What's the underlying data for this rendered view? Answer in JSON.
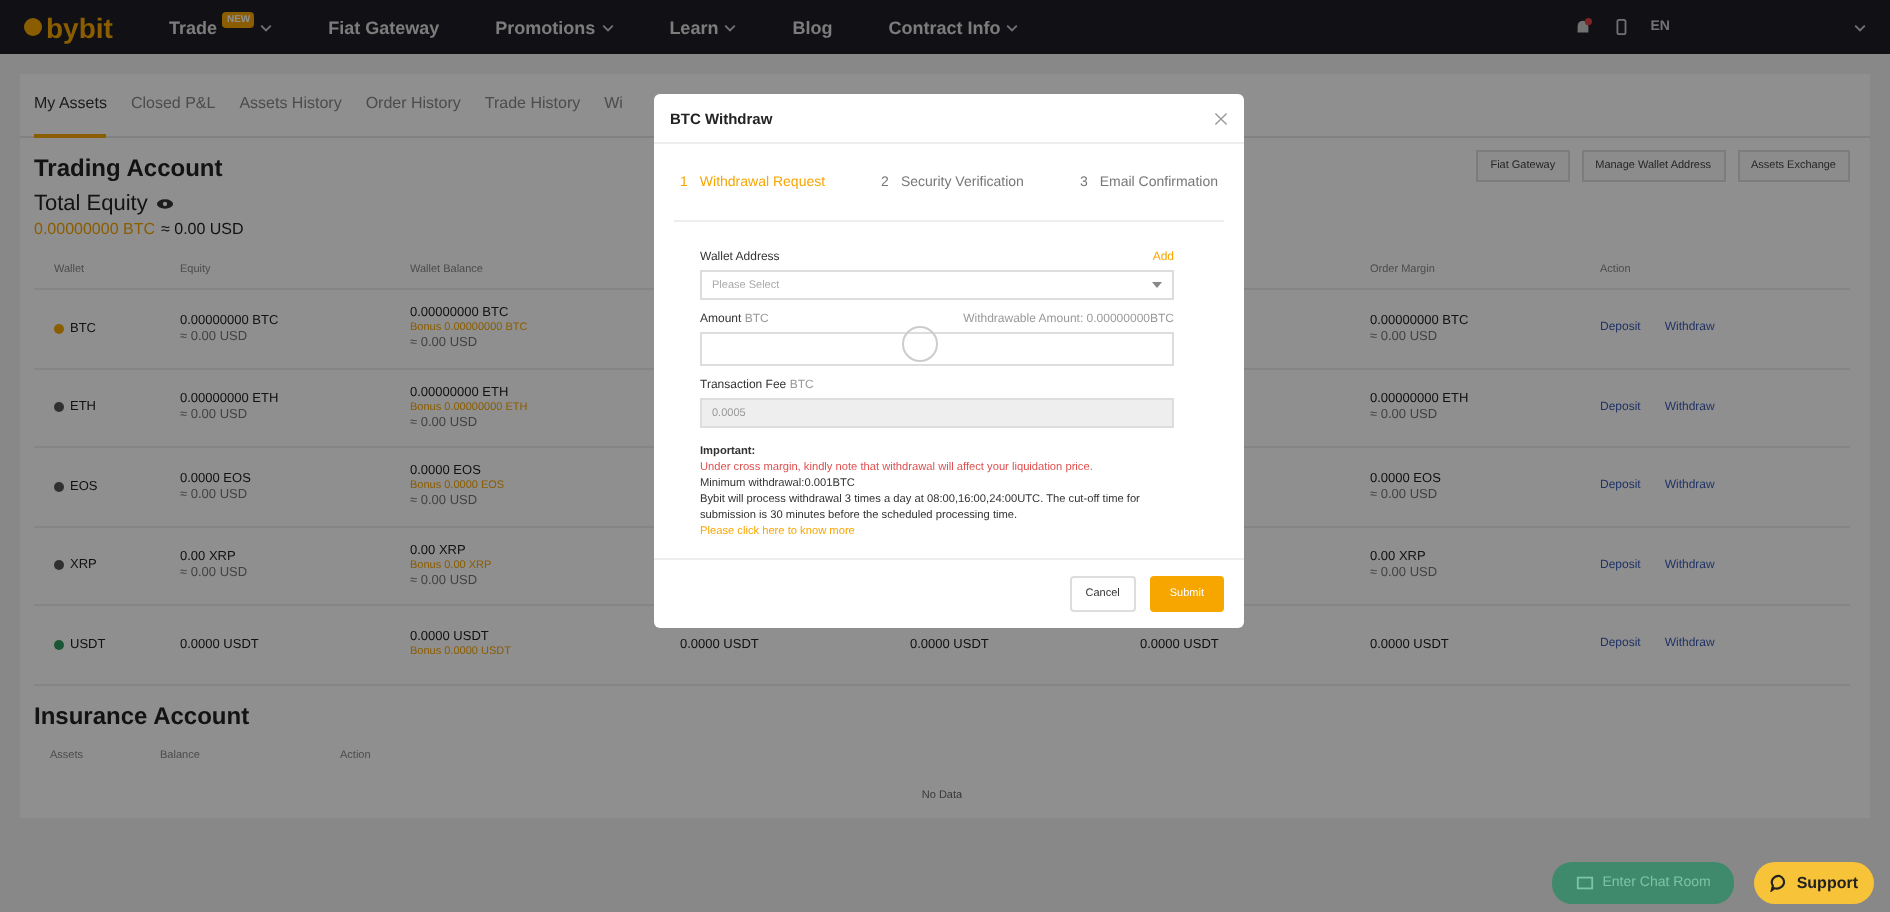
{
  "nav": {
    "logo": "bybit",
    "items": [
      {
        "label": "Trade",
        "badge": "NEW",
        "caret": true
      },
      {
        "label": "Fiat Gateway",
        "caret": false
      },
      {
        "label": "Promotions",
        "caret": true
      },
      {
        "label": "Learn",
        "caret": true
      },
      {
        "label": "Blog",
        "caret": false
      },
      {
        "label": "Contract Info",
        "caret": true
      }
    ],
    "language": "EN"
  },
  "tabs": [
    {
      "label": "My Assets",
      "selected": true
    },
    {
      "label": "Closed P&L",
      "selected": false
    },
    {
      "label": "Assets History",
      "selected": false
    },
    {
      "label": "Order History",
      "selected": false
    },
    {
      "label": "Trade History",
      "selected": false
    },
    {
      "label": "Wi",
      "selected": false
    }
  ],
  "trading_account": {
    "title": "Trading Account",
    "buttons": [
      "Fiat Gateway",
      "Manage Wallet Address",
      "Assets Exchange"
    ],
    "total_equity": {
      "label": "Total Equity",
      "btc": "0.00000000 BTC",
      "usd": "≈ 0.00 USD"
    },
    "columns": {
      "wallet": "Wallet",
      "equity": "Equity",
      "wallet_balance": "Wallet Balance",
      "order_margin": "Order Margin",
      "action": "Action"
    },
    "rows": [
      {
        "wallet": "BTC",
        "color": "#8a5d00",
        "equity": [
          {
            "kind": "main",
            "text": "0.00000000 BTC"
          },
          {
            "kind": "usd",
            "text": "≈ 0.00 USD"
          }
        ],
        "wallet_balance": [
          {
            "kind": "main",
            "text": "0.00000000 BTC"
          },
          {
            "kind": "bonus",
            "text": "Bonus 0.00000000 BTC"
          },
          {
            "kind": "usd",
            "text": "≈ 0.00 USD"
          }
        ],
        "order_margin": [
          {
            "kind": "main",
            "text": "0.00000000 BTC"
          },
          {
            "kind": "usd",
            "text": "≈ 0.00 USD"
          }
        ],
        "actions": [
          "Deposit",
          "Withdraw"
        ]
      },
      {
        "wallet": "ETH",
        "color": "#303030",
        "equity": [
          {
            "kind": "main",
            "text": "0.00000000 ETH"
          },
          {
            "kind": "usd",
            "text": "≈ 0.00 USD"
          }
        ],
        "wallet_balance": [
          {
            "kind": "main",
            "text": "0.00000000 ETH"
          },
          {
            "kind": "bonus",
            "text": "Bonus 0.00000000 ETH"
          },
          {
            "kind": "usd",
            "text": "≈ 0.00 USD"
          }
        ],
        "order_margin": [
          {
            "kind": "main",
            "text": "0.00000000 ETH"
          },
          {
            "kind": "usd",
            "text": "≈ 0.00 USD"
          }
        ],
        "actions": [
          "Deposit",
          "Withdraw"
        ]
      },
      {
        "wallet": "EOS",
        "color": "#303030",
        "equity": [
          {
            "kind": "main",
            "text": "0.0000 EOS"
          },
          {
            "kind": "usd",
            "text": "≈ 0.00 USD"
          }
        ],
        "wallet_balance": [
          {
            "kind": "main",
            "text": "0.0000 EOS"
          },
          {
            "kind": "bonus",
            "text": "Bonus 0.0000 EOS"
          },
          {
            "kind": "usd",
            "text": "≈ 0.00 USD"
          }
        ],
        "order_margin": [
          {
            "kind": "main",
            "text": "0.0000 EOS"
          },
          {
            "kind": "usd",
            "text": "≈ 0.00 USD"
          }
        ],
        "actions": [
          "Deposit",
          "Withdraw"
        ]
      },
      {
        "wallet": "XRP",
        "color": "#303030",
        "equity": [
          {
            "kind": "main",
            "text": "0.00 XRP"
          },
          {
            "kind": "usd",
            "text": "≈ 0.00 USD"
          }
        ],
        "wallet_balance": [
          {
            "kind": "main",
            "text": "0.00 XRP"
          },
          {
            "kind": "bonus",
            "text": "Bonus 0.00 XRP"
          },
          {
            "kind": "usd",
            "text": "≈ 0.00 USD"
          }
        ],
        "order_margin": [
          {
            "kind": "main",
            "text": "0.00 XRP"
          },
          {
            "kind": "usd",
            "text": "≈ 0.00 USD"
          }
        ],
        "actions": [
          "Deposit",
          "Withdraw"
        ]
      },
      {
        "wallet": "USDT",
        "color": "#1a5635",
        "equity": [
          {
            "kind": "main",
            "text": "0.0000 USDT"
          }
        ],
        "wallet_balance": [
          {
            "kind": "main",
            "text": "0.0000 USDT"
          },
          {
            "kind": "bonus",
            "text": "Bonus 0.0000 USDT"
          }
        ],
        "column_4": [
          {
            "kind": "main",
            "text": "0.0000 USDT"
          }
        ],
        "column_5": [
          {
            "kind": "main",
            "text": "0.0000 USDT"
          }
        ],
        "column_6": [
          {
            "kind": "main",
            "text": "0.0000 USDT"
          }
        ],
        "order_margin": [
          {
            "kind": "main",
            "text": "0.0000 USDT"
          }
        ],
        "actions": [
          "Deposit",
          "Withdraw"
        ]
      }
    ]
  },
  "insurance_account": {
    "title": "Insurance Account",
    "columns": [
      "Assets",
      "Balance",
      "Action"
    ],
    "empty_text": "No Data"
  },
  "modal": {
    "title": "BTC Withdraw",
    "steps": [
      {
        "number": "1",
        "label": "Withdrawal Request",
        "selected": true
      },
      {
        "number": "2",
        "label": "Security Verification",
        "selected": false
      },
      {
        "number": "3",
        "label": "Email Confirmation",
        "selected": false
      }
    ],
    "wallet_address": {
      "label": "Wallet Address",
      "link": "Add",
      "placeholder": "Please Select"
    },
    "amount": {
      "label": "Amount",
      "unit": "BTC",
      "available": "Withdrawable Amount: 0.00000000BTC"
    },
    "fee": {
      "label": "Transaction Fee",
      "unit": "BTC",
      "value": "0.0005",
      "disabled": true
    },
    "notes": [
      {
        "kind": "heading",
        "text": "Important:"
      },
      {
        "kind": "warning",
        "text": "Under cross margin, kindly note that withdrawal will affect your liquidation price."
      },
      {
        "kind": "plain",
        "text": "Minimum withdrawal:0.001BTC"
      },
      {
        "kind": "plain",
        "text": "Bybit will process withdrawal 3 times a day at 08:00,16:00,24:00UTC. The cut-off time for submission is 30 minutes before the scheduled processing time."
      },
      {
        "kind": "link",
        "text": "Please click here to know more"
      }
    ],
    "buttons": [
      {
        "kind": "secondary",
        "label": "Cancel"
      },
      {
        "kind": "primary",
        "label": "Submit"
      }
    ]
  },
  "floating": {
    "chat": "Enter Chat Room",
    "support": "Support"
  }
}
